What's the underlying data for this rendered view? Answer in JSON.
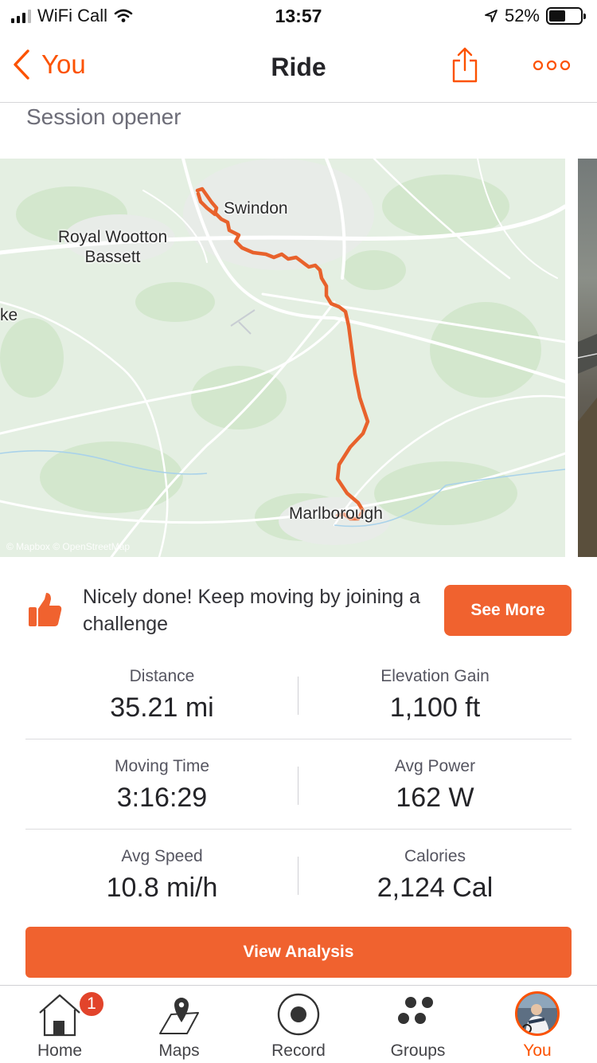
{
  "status_bar": {
    "carrier": "WiFi Call",
    "time": "13:57",
    "battery": "52%",
    "battery_level": 0.52
  },
  "nav": {
    "back_label": "You",
    "title": "Ride"
  },
  "activity": {
    "title": "Session opener"
  },
  "map": {
    "labels": {
      "swindon": "Swindon",
      "royal_wootton": "Royal Wootton",
      "bassett": "Bassett",
      "marlborough": "Marlborough",
      "edge_fragment": "ke"
    },
    "attribution": "© Mapbox © OpenStreetMap",
    "route_color": "#e8622c"
  },
  "challenge": {
    "text": "Nicely done! Keep moving by joining a challenge",
    "button_label": "See More"
  },
  "stats": [
    {
      "left": {
        "label": "Distance",
        "value": "35.21 mi"
      },
      "right": {
        "label": "Elevation Gain",
        "value": "1,100 ft"
      }
    },
    {
      "left": {
        "label": "Moving Time",
        "value": "3:16:29"
      },
      "right": {
        "label": "Avg Power",
        "value": "162 W"
      }
    },
    {
      "left": {
        "label": "Avg Speed",
        "value": "10.8 mi/h"
      },
      "right": {
        "label": "Calories",
        "value": "2,124 Cal"
      }
    }
  ],
  "view_analysis_label": "View Analysis",
  "tab_bar": {
    "tabs": [
      {
        "label": "Home",
        "icon": "home-icon",
        "badge": "1"
      },
      {
        "label": "Maps",
        "icon": "map-pin-icon"
      },
      {
        "label": "Record",
        "icon": "record-icon"
      },
      {
        "label": "Groups",
        "icon": "groups-icon"
      },
      {
        "label": "You",
        "icon": "avatar",
        "active": true
      }
    ]
  },
  "colors": {
    "accent": "#fc5200",
    "button": "#f0622f",
    "text": "#242428"
  }
}
